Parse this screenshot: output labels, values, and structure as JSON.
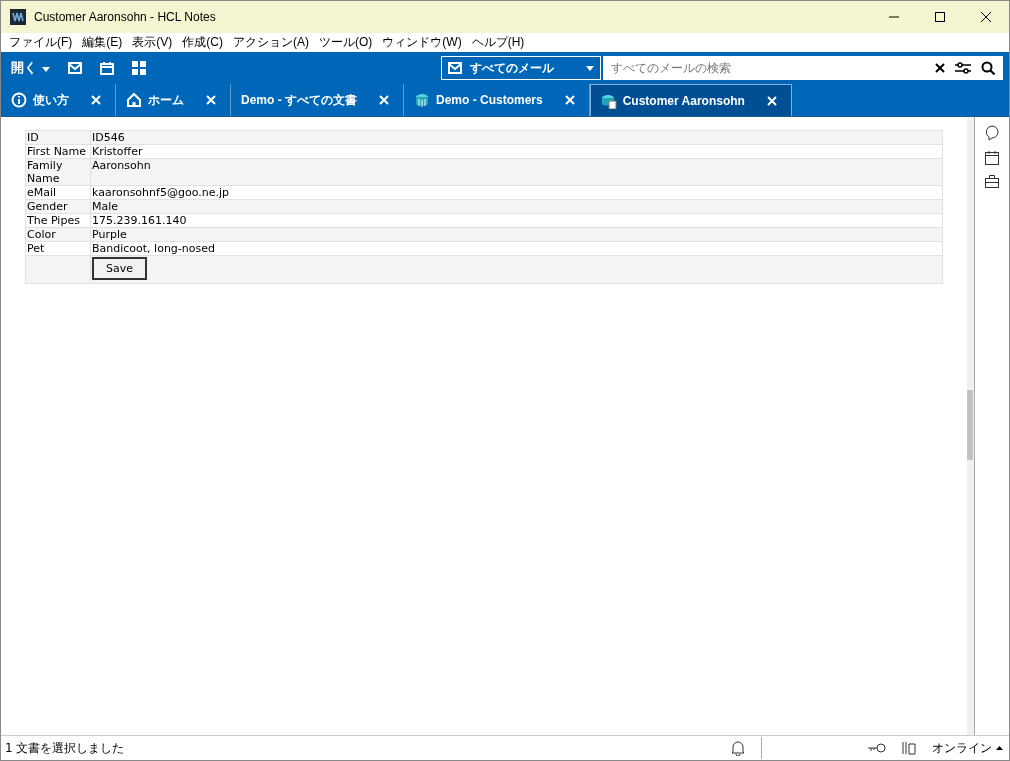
{
  "window": {
    "title": "Customer Aaronsohn - HCL Notes"
  },
  "menu": [
    "ファイル(F)",
    "編集(E)",
    "表示(V)",
    "作成(C)",
    "アクション(A)",
    "ツール(O)",
    "ウィンドウ(W)",
    "ヘルプ(H)"
  ],
  "toolbar": {
    "open_label": "開く",
    "scope": "すべてのメール",
    "search": {
      "placeholder": "すべてのメールの検索"
    }
  },
  "tabs": [
    {
      "label": "使い方",
      "kind": "info",
      "selected": false
    },
    {
      "label": "ホーム",
      "kind": "home",
      "selected": false
    },
    {
      "label": "Demo - すべての文書",
      "kind": "plain",
      "selected": false
    },
    {
      "label": "Demo - Customers",
      "kind": "database",
      "selected": false
    },
    {
      "label": "Customer Aaronsohn",
      "kind": "document",
      "selected": true
    }
  ],
  "form": {
    "rows": [
      {
        "label": "ID",
        "value": "ID546"
      },
      {
        "label": "First Name",
        "value": "Kristoffer"
      },
      {
        "label": "Family Name",
        "value": "Aaronsohn"
      },
      {
        "label": "eMail",
        "value": "kaaronsohnf5@goo.ne.jp"
      },
      {
        "label": "Gender",
        "value": "Male"
      },
      {
        "label": "The Pipes",
        "value": "175.239.161.140"
      },
      {
        "label": "Color",
        "value": "Purple"
      },
      {
        "label": "Pet",
        "value": "Bandicoot, long-nosed"
      }
    ],
    "save_button": "Save"
  },
  "status_bar": {
    "message": "1 文書を選択しました",
    "status": "オンライン"
  }
}
